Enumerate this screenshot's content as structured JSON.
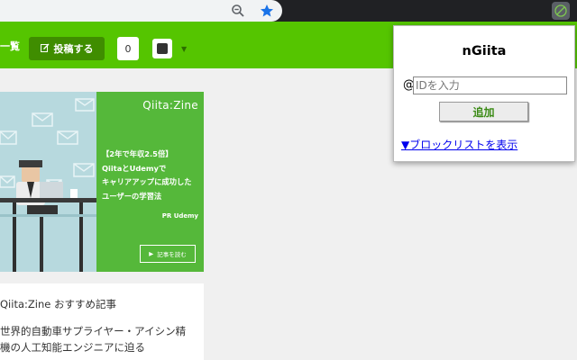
{
  "browser": {
    "zoom_icon": "zoom-out-icon",
    "bookmark_icon": "star-icon",
    "extension_icon": "ngiita-extension-icon"
  },
  "header": {
    "nav_text": "一覧",
    "post_button": "投稿する",
    "post_icon": "pencil-icon",
    "count": "0",
    "colors": {
      "header_bg": "#55c500",
      "post_btn_bg": "#3f8d00"
    }
  },
  "ad": {
    "logo": "Qiita:Zine",
    "lines": [
      "【2年で年収2.5倍】",
      "QiitaとUdemyで",
      "キャリアアップに成功した",
      "ユーザーの学習法"
    ],
    "pr": "PR Udemy",
    "read_button": "記事を読む",
    "colors": {
      "green": "#55b83a",
      "image_bg": "#b7d9de"
    }
  },
  "recommend": {
    "title": "Qiita:Zine おすすめ記事",
    "article_line1": "世界的自動車サプライヤー・アイシン精",
    "article_line2": "機の人工知能エンジニアに迫る"
  },
  "popup": {
    "title": "nGiita",
    "at_symbol": "@",
    "input_placeholder": "IDを入力",
    "input_value": "",
    "add_button": "追加",
    "block_list_link": "▼ブロックリストを表示"
  }
}
